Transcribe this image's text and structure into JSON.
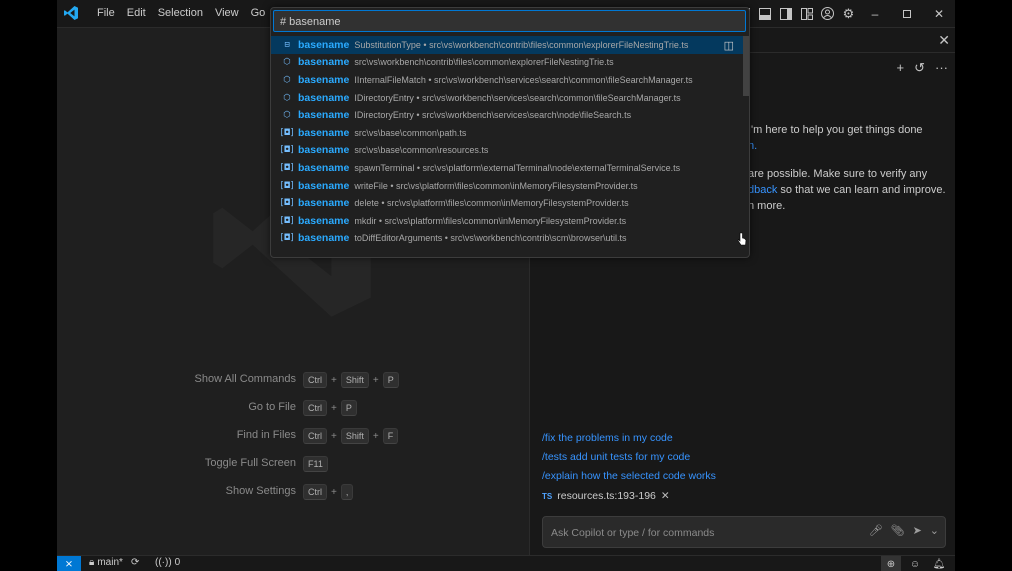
{
  "menu": [
    "File",
    "Edit",
    "Selection",
    "View",
    "Go"
  ],
  "quick_pick": {
    "value": "# basename",
    "results": [
      {
        "icon": "class-icon",
        "name": "basename",
        "detail": "SubstitutionType • src\\vs\\workbench\\contrib\\files\\common\\explorerFileNestingTrie.ts"
      },
      {
        "icon": "cube-icon",
        "name": "basename",
        "detail": "src\\vs\\workbench\\contrib\\files\\common\\explorerFileNestingTrie.ts"
      },
      {
        "icon": "cube-icon",
        "name": "basename",
        "detail": "IInternalFileMatch • src\\vs\\workbench\\services\\search\\common\\fileSearchManager.ts"
      },
      {
        "icon": "cube-icon",
        "name": "basename",
        "detail": "IDirectoryEntry • src\\vs\\workbench\\services\\search\\common\\fileSearchManager.ts"
      },
      {
        "icon": "cube-icon",
        "name": "basename",
        "detail": "IDirectoryEntry • src\\vs\\workbench\\services\\search\\node\\fileSearch.ts"
      },
      {
        "icon": "variable-icon",
        "name": "basename",
        "detail": "src\\vs\\base\\common\\path.ts"
      },
      {
        "icon": "variable-icon",
        "name": "basename",
        "detail": "src\\vs\\base\\common\\resources.ts"
      },
      {
        "icon": "variable-icon",
        "name": "basename",
        "detail": "spawnTerminal • src\\vs\\platform\\externalTerminal\\node\\externalTerminalService.ts"
      },
      {
        "icon": "variable-icon",
        "name": "basename",
        "detail": "writeFile • src\\vs\\platform\\files\\common\\inMemoryFilesystemProvider.ts"
      },
      {
        "icon": "variable-icon",
        "name": "basename",
        "detail": "delete • src\\vs\\platform\\files\\common\\inMemoryFilesystemProvider.ts"
      },
      {
        "icon": "variable-icon",
        "name": "basename",
        "detail": "mkdir • src\\vs\\platform\\files\\common\\inMemoryFilesystemProvider.ts"
      },
      {
        "icon": "variable-icon",
        "name": "basename",
        "detail": "toDiffEditorArguments • src\\vs\\workbench\\contrib\\scm\\browser\\util.ts"
      }
    ]
  },
  "shortcuts": [
    {
      "label": "Show All Commands",
      "keys": [
        "Ctrl",
        "Shift",
        "P"
      ]
    },
    {
      "label": "Go to File",
      "keys": [
        "Ctrl",
        "P"
      ]
    },
    {
      "label": "Find in Files",
      "keys": [
        "Ctrl",
        "Shift",
        "F"
      ]
    },
    {
      "label": "Toggle Full Screen",
      "keys": [
        "F11"
      ]
    },
    {
      "label": "Show Settings",
      "keys": [
        "Ctrl",
        ","
      ]
    }
  ],
  "chat": {
    "line1": "I'm here to help you get things done",
    "line2_link": "n.",
    "line3": "are possible. Make sure to verify any",
    "line4_link": "dback",
    "line4_rest": " so that we can learn and improve.",
    "line5": "n more.",
    "suggestions": [
      "/fix the problems in my code",
      "/tests add unit tests for my code",
      "/explain how the selected code works"
    ],
    "reference_badge": "TS",
    "reference": "resources.ts:193-196",
    "input_placeholder": "Ask Copilot or type / for commands"
  },
  "status": {
    "branch": "main*",
    "ports": "0"
  },
  "colors": {
    "accent": "#0078d4",
    "link": "#3794ff",
    "match": "#2aaaff",
    "selection": "#04395e"
  }
}
